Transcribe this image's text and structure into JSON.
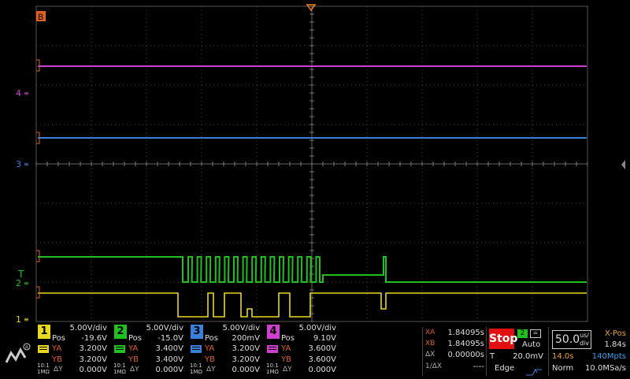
{
  "trigger_marker": "B",
  "channel_markers": [
    {
      "id": "4",
      "label": "4",
      "color": "#d040d0"
    },
    {
      "id": "3",
      "label": "3",
      "color": "#3a7fd8"
    },
    {
      "id": "2",
      "label": "2",
      "color": "#20c020"
    },
    {
      "id": "1",
      "label": "1",
      "color": "#e8d820"
    }
  ],
  "trigger_level_marker": "T",
  "channels": [
    {
      "num": "1",
      "color": "#e8d820",
      "vdiv": "5.00V/div",
      "pos_label": "Pos",
      "pos": "-19.6V",
      "ya_label": "YA",
      "ya": "3.200V",
      "yb_label": "YB",
      "yb": "3.200V",
      "dy_label": "ΔY",
      "dy": "0.000V",
      "probe": "10:1",
      "imp": "1MΩ"
    },
    {
      "num": "2",
      "color": "#20c020",
      "vdiv": "5.00V/div",
      "pos_label": "Pos",
      "pos": "-15.0V",
      "ya_label": "YA",
      "ya": "3.400V",
      "yb_label": "YB",
      "yb": "3.400V",
      "dy_label": "ΔY",
      "dy": "0.000V",
      "probe": "10:1",
      "imp": "1MΩ"
    },
    {
      "num": "3",
      "color": "#3a7fd8",
      "vdiv": "5.00V/div",
      "pos_label": "Pos",
      "pos": "200mV",
      "ya_label": "YA",
      "ya": "3.200V",
      "yb_label": "YB",
      "yb": "3.200V",
      "dy_label": "ΔY",
      "dy": "0.000V",
      "probe": "10:1",
      "imp": "1MΩ"
    },
    {
      "num": "4",
      "color": "#d040d0",
      "vdiv": "5.00V/div",
      "pos_label": "Pos",
      "pos": "9.10V",
      "ya_label": "YA",
      "ya": "3.600V",
      "yb_label": "YB",
      "yb": "3.600V",
      "dy_label": "ΔY",
      "dy": "0.000V",
      "probe": "10:1",
      "imp": "1MΩ"
    }
  ],
  "cursors": {
    "xa_label": "XA",
    "xa": "1.84095s",
    "xb_label": "XB",
    "xb": "1.84095s",
    "dx_label": "ΔX",
    "dx": "0.00000s",
    "inv_label": "1/ΔX",
    "inv": "----"
  },
  "run": {
    "state": "Stop",
    "trig_source": "2",
    "mode": "Auto",
    "t_label": "T",
    "t_level": "20.0mV",
    "edge": "Edge"
  },
  "timebase": {
    "value": "50.0",
    "unit_top": "us/",
    "unit_bottom": "div",
    "xpos_label": "X-Pos",
    "xpos": "1.84s",
    "time": "14.0s",
    "mpts": "140Mpts",
    "norm": "Norm",
    "rate": "10.0MSa/s"
  },
  "logo": "ZLG"
}
